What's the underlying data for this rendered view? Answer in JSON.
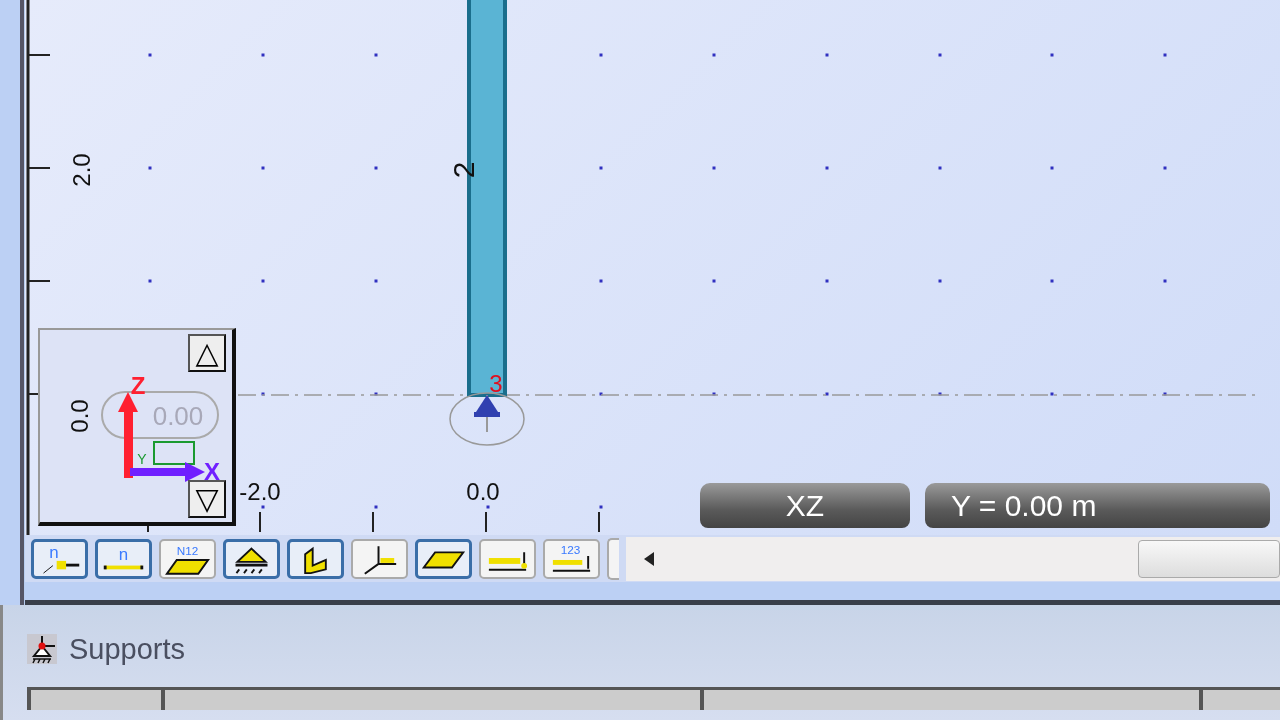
{
  "viewport": {
    "y_axis_labels": [
      "2.0",
      "0.0"
    ],
    "x_axis_labels": [
      "-2.0",
      "0.0"
    ],
    "member_label": "2",
    "node_label": "3",
    "view_plane": "XZ",
    "section_value": "Y = 0.00 m",
    "gizmo": {
      "axes": [
        "Z",
        "X",
        "Y"
      ],
      "ghost_value": "0.00",
      "up_button": "△",
      "down_button": "▽"
    }
  },
  "toolbar": {
    "buttons": [
      {
        "kind": "node-numbers",
        "label": "n",
        "selected": true
      },
      {
        "kind": "line-numbers",
        "label": "n",
        "selected": true
      },
      {
        "kind": "surface-numbers",
        "label": "N12",
        "selected": false
      },
      {
        "kind": "support",
        "selected": true
      },
      {
        "kind": "member",
        "selected": true
      },
      {
        "kind": "axes",
        "selected": false
      },
      {
        "kind": "surface",
        "selected": true
      },
      {
        "kind": "dimension",
        "selected": false
      },
      {
        "kind": "dimension-numbered",
        "label": "123",
        "selected": false
      }
    ]
  },
  "panel": {
    "title": "Supports"
  }
}
